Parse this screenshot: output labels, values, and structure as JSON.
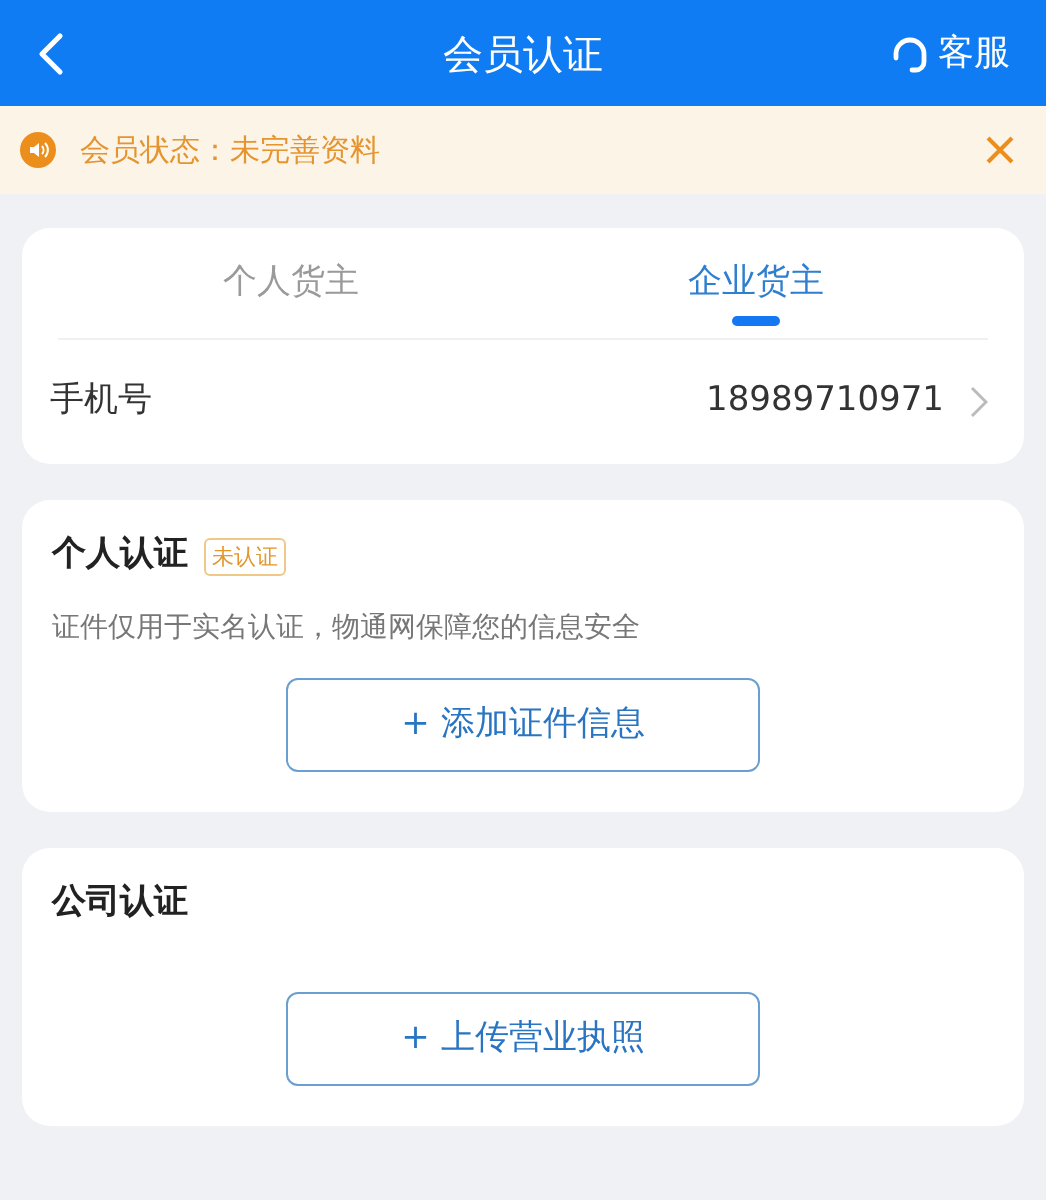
{
  "header": {
    "title": "会员认证",
    "service": "客服"
  },
  "notice": {
    "text": "会员状态：未完善资料"
  },
  "tabs": [
    {
      "label": "个人货主",
      "selected": false
    },
    {
      "label": "企业货主",
      "selected": true
    }
  ],
  "phone": {
    "label": "手机号",
    "value": "18989710971"
  },
  "sections": [
    {
      "title": "个人认证",
      "badge": "未认证",
      "description": "证件仅用于实名认证，物通网保障您的信息安全",
      "button": "+ 添加证件信息"
    },
    {
      "title": "公司认证",
      "button": "+ 上传营业执照"
    }
  ]
}
